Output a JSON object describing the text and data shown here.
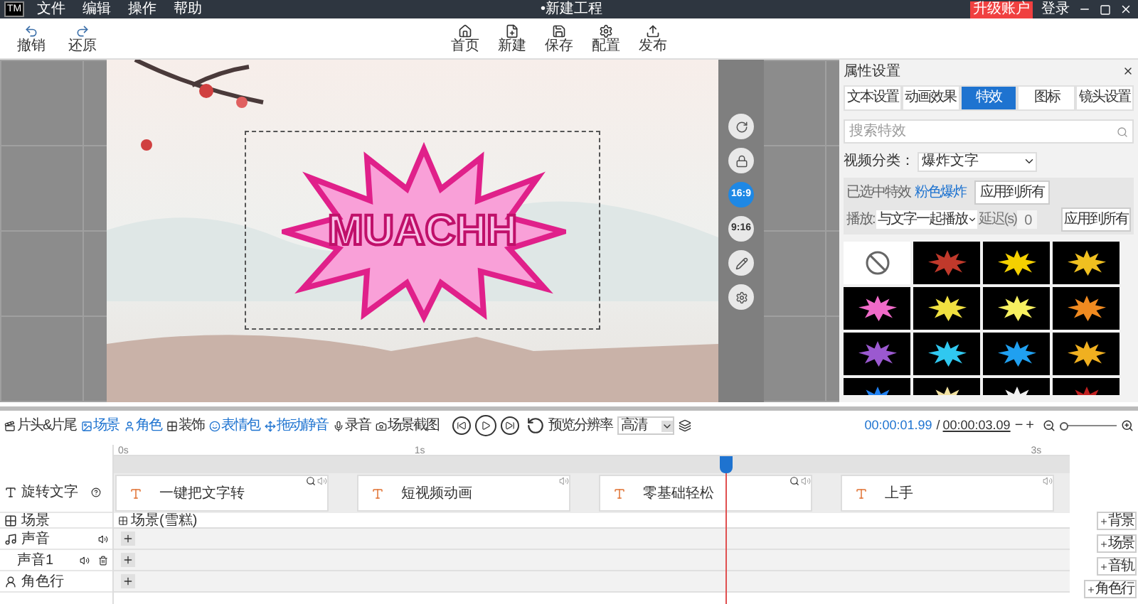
{
  "title_bar": {
    "logo": "TM",
    "menu": [
      "文件",
      "编辑",
      "操作",
      "帮助"
    ],
    "title": "•新建工程",
    "upgrade": "升级账户",
    "login": "登录"
  },
  "toolbar": {
    "left": [
      {
        "kind": "undo",
        "label": "撤销"
      },
      {
        "kind": "redo",
        "label": "还原"
      }
    ],
    "center": [
      {
        "kind": "home",
        "label": "首页"
      },
      {
        "kind": "new",
        "label": "新建"
      },
      {
        "kind": "save",
        "label": "保存"
      },
      {
        "kind": "config",
        "label": "配置"
      },
      {
        "kind": "publish",
        "label": "发布"
      }
    ]
  },
  "canvas": {
    "sticker_text": "MUACHH"
  },
  "canvas_tools": [
    {
      "kind": "rotate"
    },
    {
      "kind": "lock"
    },
    {
      "kind": "ratio",
      "label": "16:9",
      "selected": true
    },
    {
      "kind": "ratio",
      "label": "9:16",
      "selected": false
    },
    {
      "kind": "edit"
    },
    {
      "kind": "settings"
    }
  ],
  "panel": {
    "title": "属性设置",
    "tabs": [
      {
        "label": "文本设置",
        "selected": false
      },
      {
        "label": "动画效果",
        "selected": false
      },
      {
        "label": "特效",
        "selected": true
      },
      {
        "label": "图标",
        "selected": false
      },
      {
        "label": "镜头设置",
        "selected": false
      }
    ],
    "search": {
      "placeholder": "搜索特效"
    },
    "category": {
      "label": "视频分类：",
      "value": "爆炸文字"
    },
    "selected_effect": {
      "label": "已选中特效",
      "name": "粉色爆炸",
      "apply": "应用到所有"
    },
    "play": {
      "label": "播放:",
      "value": "与文字一起播放",
      "delay_label": "延迟(s)",
      "delay_value": "0",
      "apply": "应用到所有"
    },
    "effects": [
      {
        "kind": "none"
      },
      {
        "kind": "burst",
        "color": "#c0392b"
      },
      {
        "kind": "burst",
        "color": "#f5d000"
      },
      {
        "kind": "burst",
        "color": "#f0c020"
      },
      {
        "kind": "burst",
        "color": "#f06ac8"
      },
      {
        "kind": "burst",
        "color": "#f0e040"
      },
      {
        "kind": "burst",
        "color": "#f7f060"
      },
      {
        "kind": "burst",
        "color": "#f08a20"
      },
      {
        "kind": "burst",
        "color": "#9b59d0"
      },
      {
        "kind": "burst",
        "color": "#30c8f0"
      },
      {
        "kind": "burst",
        "color": "#20a0f0"
      },
      {
        "kind": "burst",
        "color": "#f0b020"
      },
      {
        "kind": "burst",
        "color": "#2080f0"
      },
      {
        "kind": "burst",
        "color": "#f0e0a0"
      },
      {
        "kind": "burst",
        "color": "#f0f0f0"
      },
      {
        "kind": "burst",
        "color": "#c02020"
      }
    ]
  },
  "bottom_toolbar": {
    "items": [
      {
        "kind": "intro",
        "label": "片头&片尾",
        "accent": false
      },
      {
        "kind": "scene",
        "label": "场景",
        "accent": true
      },
      {
        "kind": "character",
        "label": "角色",
        "accent": true
      },
      {
        "kind": "decor",
        "label": "装饰",
        "accent": false
      },
      {
        "kind": "emoji",
        "label": "表情包",
        "accent": true
      },
      {
        "kind": "mute",
        "label": "拖动静音",
        "accent": true
      },
      {
        "kind": "record",
        "label": "录音",
        "accent": false
      },
      {
        "kind": "screenshot",
        "label": "场景截图",
        "accent": false
      }
    ],
    "zoom_slider": {
      "level": 0
    },
    "resolution_label": "预览分辨率",
    "resolution": "高清",
    "current_time": "00:00:01.99",
    "separator": "/",
    "total_time": "00:00:03.09",
    "minus": "−",
    "plus": "+"
  },
  "timeline": {
    "ticks": [
      {
        "label": "0s",
        "level": 0
      },
      {
        "label": "1s",
        "level": 0.31
      },
      {
        "label": "3s",
        "level": 0.955
      }
    ],
    "playhead": {
      "level": 0.64
    },
    "tracks": [
      {
        "kind": "text",
        "label": "旋转文字"
      },
      {
        "kind": "scene",
        "label": "场景"
      },
      {
        "kind": "sound",
        "label": "声音"
      },
      {
        "kind": "sound_sub",
        "label": "声音1"
      },
      {
        "kind": "character",
        "label": "角色行"
      }
    ],
    "clips": [
      {
        "text": "一键把文字转",
        "zoom": true
      },
      {
        "text": "短视频动画",
        "zoom": false
      },
      {
        "text": "零基础轻松",
        "zoom": true
      },
      {
        "text": "上手",
        "zoom": false
      }
    ],
    "scene_bar": "场景(雪糕)",
    "add_buttons": [
      {
        "label": "背景"
      },
      {
        "label": "场景"
      },
      {
        "label": "音轨"
      },
      {
        "label": "角色行"
      }
    ]
  }
}
